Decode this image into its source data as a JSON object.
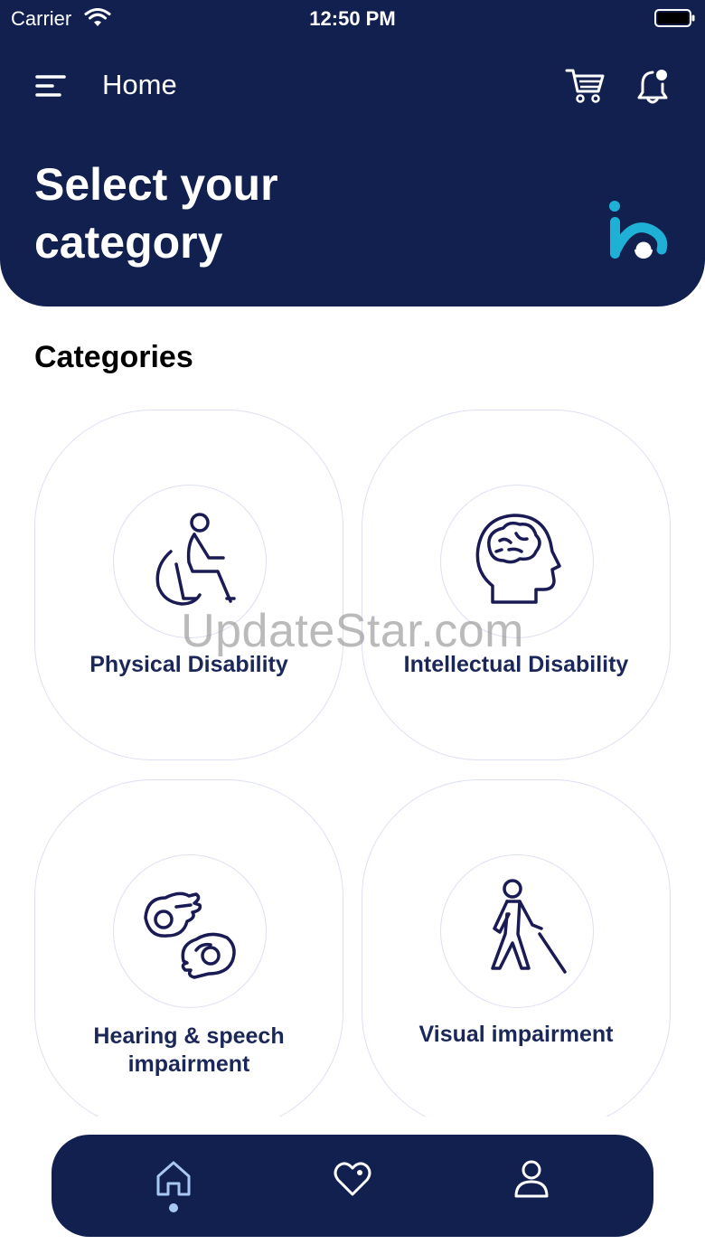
{
  "status_bar": {
    "carrier": "Carrier",
    "time": "12:50 PM"
  },
  "header": {
    "title": "Home",
    "hero_line1": "Select your",
    "hero_line2": "category"
  },
  "section": {
    "title": "Categories"
  },
  "categories": [
    {
      "label": "Physical Disability",
      "icon": "wheelchair-icon"
    },
    {
      "label": "Intellectual Disability",
      "icon": "brain-head-icon"
    },
    {
      "label_line1": "Hearing & speech",
      "label_line2": "impairment",
      "icon": "sign-language-icon"
    },
    {
      "label": "Visual impairment",
      "icon": "blind-person-icon"
    }
  ],
  "watermark": "UpdateStar.com",
  "bottom_nav": [
    {
      "name": "home",
      "icon": "home-icon",
      "active": true
    },
    {
      "name": "favorites",
      "icon": "heart-icon",
      "active": false
    },
    {
      "name": "profile",
      "icon": "user-icon",
      "active": false
    }
  ],
  "colors": {
    "primary": "#12204f",
    "accent": "#1fb0d6",
    "card_border": "#dde0f2",
    "active_dot": "#a9c7f5"
  }
}
